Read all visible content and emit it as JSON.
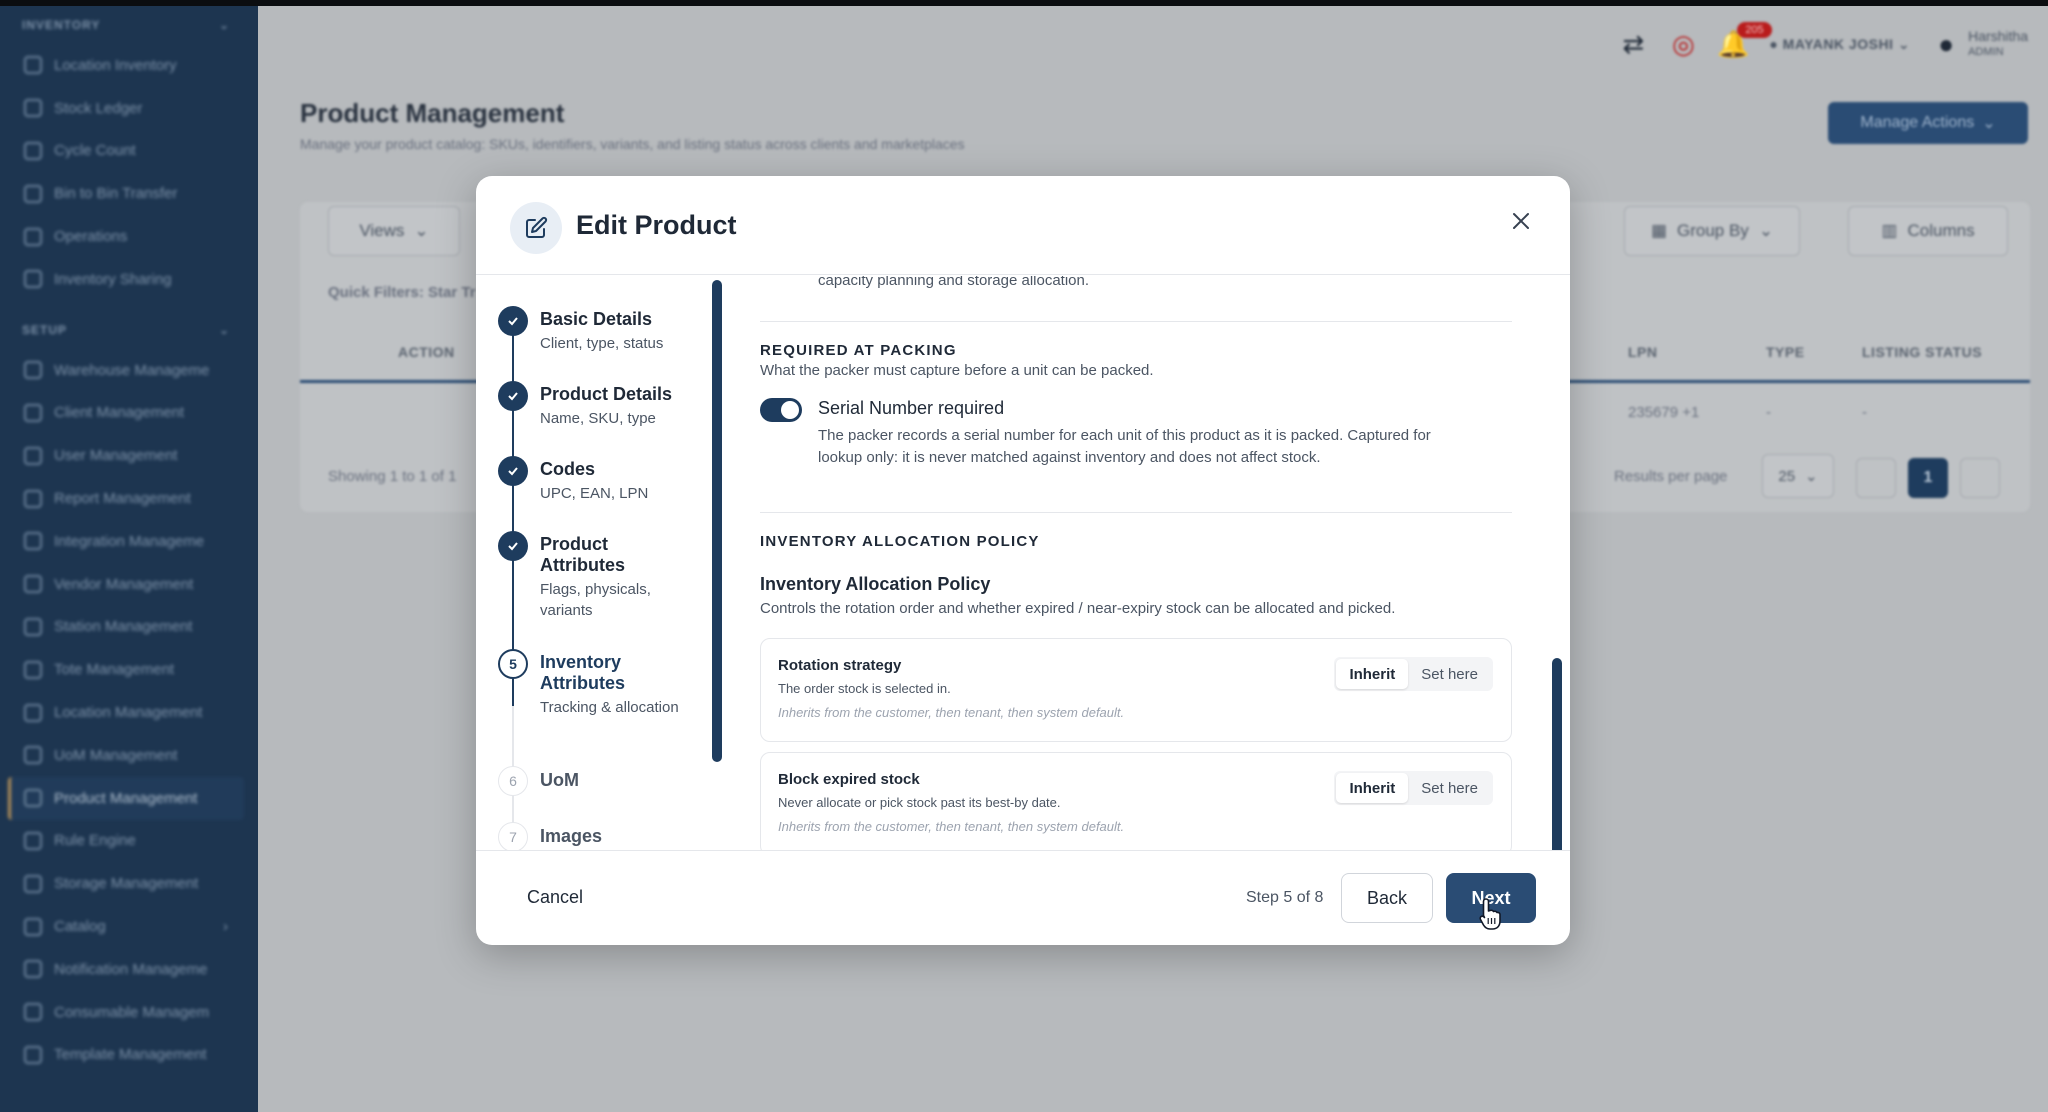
{
  "sidebar": {
    "sections": [
      {
        "label": "INVENTORY",
        "items": [
          "Location Inventory",
          "Stock Ledger",
          "Cycle Count",
          "Bin to Bin Transfer",
          "Operations",
          "Inventory Sharing"
        ]
      },
      {
        "label": "SETUP",
        "items": [
          "Warehouse Manageme",
          "Client Management",
          "User Management",
          "Report Management",
          "Integration Manageme",
          "Vendor Management",
          "Station Management",
          "Tote Management",
          "Location Management",
          "UoM Management",
          "Product Management",
          "Rule Engine",
          "Storage Management",
          "Catalog",
          "Notification Manageme",
          "Consumable Managem",
          "Template Management"
        ]
      }
    ],
    "active_item": "Product Management"
  },
  "header": {
    "notifications_count": "205",
    "warehouse_user": "MAYANK JOSHI",
    "user_name": "Harshitha",
    "user_role": "ADMIN"
  },
  "page": {
    "title": "Product Management",
    "subtitle": "Manage your product catalog: SKUs, identifiers, variants, and listing status across clients and marketplaces",
    "manage_actions": "Manage Actions",
    "views": "Views",
    "group_by": "Group By",
    "columns": "Columns",
    "quick_filters": "Quick Filters:  Star Tr",
    "table_headers": {
      "action": "ACTION",
      "lpn": "LPN",
      "type": "TYPE",
      "listing_status": "LISTING STATUS"
    },
    "row": {
      "lpn": "235679 +1",
      "type": "-",
      "listing_status": "-"
    },
    "showing": "Showing 1 to 1 of 1",
    "results_per_page": "Results per page",
    "per_page_value": "25",
    "current_page": "1"
  },
  "modal": {
    "title": "Edit Product",
    "steps": [
      {
        "num": "1",
        "title": "Basic Details",
        "sub": "Client, type, status",
        "state": "done"
      },
      {
        "num": "2",
        "title": "Product Details",
        "sub": "Name, SKU, type",
        "state": "done"
      },
      {
        "num": "3",
        "title": "Codes",
        "sub": "UPC, EAN, LPN",
        "state": "done"
      },
      {
        "num": "4",
        "title": "Product Attributes",
        "sub": "Flags, physicals, variants",
        "state": "done"
      },
      {
        "num": "5",
        "title": "Inventory Attributes",
        "sub": "Tracking & allocation",
        "state": "current"
      },
      {
        "num": "6",
        "title": "UoM",
        "sub": "",
        "state": "todo"
      },
      {
        "num": "7",
        "title": "Images",
        "sub": "",
        "state": "todo"
      }
    ],
    "content": {
      "cut_text": "capacity planning and storage allocation.",
      "packing_eyebrow": "REQUIRED AT PACKING",
      "packing_desc": "What the packer must capture before a unit can be packed.",
      "serial_label": "Serial Number required",
      "serial_desc_1": "The packer records a serial number for each unit of this product as it is packed. Captured for",
      "serial_desc_2": "lookup only: it is never matched against inventory and does not affect stock.",
      "alloc_eyebrow": "INVENTORY ALLOCATION POLICY",
      "alloc_heading": "Inventory Allocation Policy",
      "alloc_desc": "Controls the rotation order and whether expired / near-expiry stock can be allocated and picked.",
      "cards": [
        {
          "title": "Rotation strategy",
          "desc": "The order stock is selected in.",
          "note": "Inherits from the customer, then tenant, then system default.",
          "opt_a": "Inherit",
          "opt_b": "Set here"
        },
        {
          "title": "Block expired stock",
          "desc": "Never allocate or pick stock past its best-by date.",
          "note": "Inherits from the customer, then tenant, then system default.",
          "opt_a": "Inherit",
          "opt_b": "Set here"
        }
      ]
    },
    "footer": {
      "cancel": "Cancel",
      "step_count": "Step 5 of 8",
      "back": "Back",
      "next": "Next"
    }
  }
}
